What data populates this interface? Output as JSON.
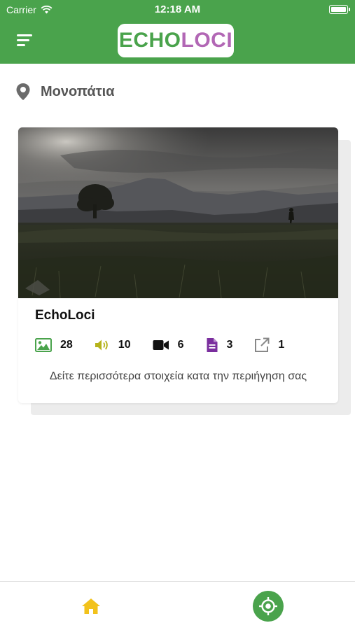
{
  "status_bar": {
    "carrier": "Carrier",
    "time": "12:18 AM"
  },
  "header": {
    "logo_part1": "ECHO",
    "logo_part2": "LOCI",
    "menu_icon": "hamburger-menu-icon"
  },
  "section": {
    "icon": "map-pin-icon",
    "title": "Μονοπάτια"
  },
  "route_card": {
    "name": "EchoLoci",
    "stats": [
      {
        "icon": "image-icon",
        "count": "28",
        "color": "#4aa34c"
      },
      {
        "icon": "volume-icon",
        "count": "10",
        "color": "#b5b31b"
      },
      {
        "icon": "video-icon",
        "count": "6",
        "color": "#111111"
      },
      {
        "icon": "document-icon",
        "count": "3",
        "color": "#7a2e9e"
      },
      {
        "icon": "external-link-icon",
        "count": "1",
        "color": "#888888"
      }
    ],
    "description": "Δείτε περισσότερα στοιχεία κατα την περιήγηση σας"
  },
  "tabbar": {
    "home_icon": "home-icon",
    "locate_icon": "locate-icon"
  },
  "colors": {
    "brand_green": "#4aa34c",
    "brand_purple": "#b267b5",
    "home_yellow": "#f2c21b"
  }
}
